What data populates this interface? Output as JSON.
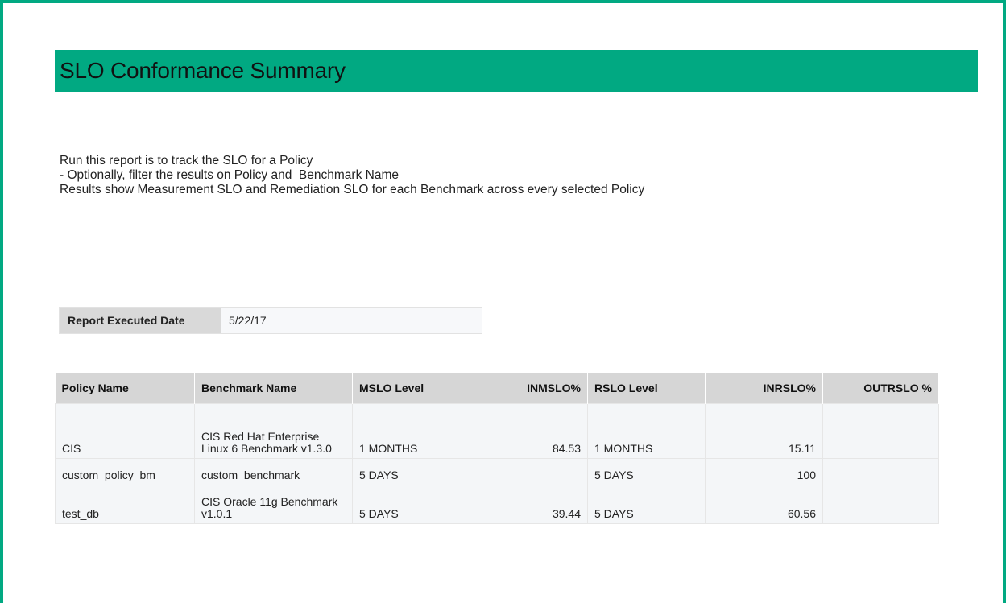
{
  "report": {
    "title": "SLO Conformance Summary",
    "description": [
      "Run this report is to track the SLO for a Policy",
      "- Optionally, filter the results on Policy and  Benchmark Name",
      "Results show Measurement SLO and Remediation SLO for each Benchmark across every selected Policy"
    ],
    "executed_label": "Report Executed Date",
    "executed_value": "5/22/17"
  },
  "colors": {
    "accent": "#01a982",
    "header_bg": "#d6d6d6",
    "row_bg": "#f4f6f8"
  },
  "table": {
    "headers": [
      "Policy Name",
      "Benchmark Name",
      "MSLO Level",
      "INMSLO%",
      "RSLO Level",
      "INRSLO%",
      "OUTRSLO %"
    ],
    "rows": [
      [
        "CIS",
        "CIS Red Hat Enterprise Linux 6 Benchmark v1.3.0",
        "1 MONTHS",
        "84.53",
        "1 MONTHS",
        "15.11",
        ""
      ],
      [
        "custom_policy_bm",
        "custom_benchmark",
        "5 DAYS",
        "",
        "5 DAYS",
        "100",
        ""
      ],
      [
        "test_db",
        "CIS Oracle 11g Benchmark v1.0.1",
        "5 DAYS",
        "39.44",
        "5 DAYS",
        "60.56",
        ""
      ]
    ]
  }
}
